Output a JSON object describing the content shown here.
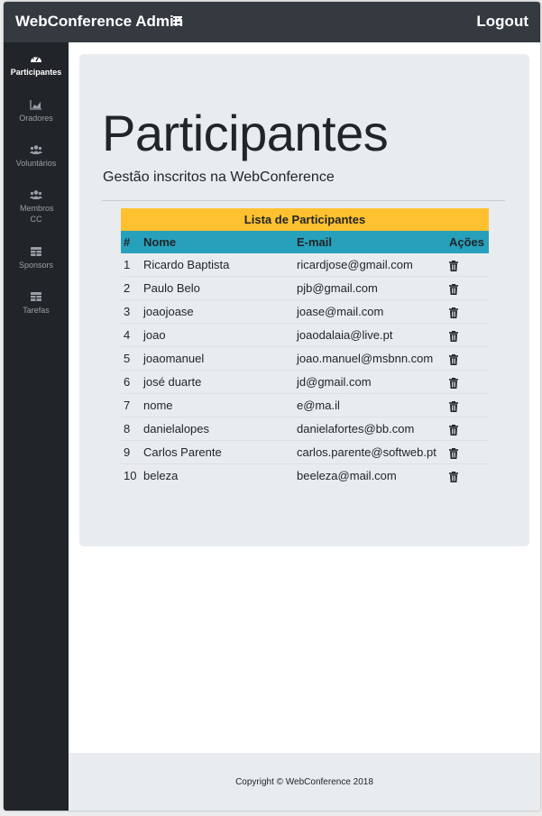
{
  "header": {
    "brand": "WebConference Admin",
    "logout": "Logout"
  },
  "sidebar": {
    "items": [
      {
        "label": "Participantes",
        "icon": "dashboard-icon",
        "active": true
      },
      {
        "label": "Oradores",
        "icon": "area-chart-icon",
        "active": false
      },
      {
        "label": "Voluntários",
        "icon": "users-icon",
        "active": false
      },
      {
        "label": "Membros CC",
        "icon": "users-icon",
        "active": false
      },
      {
        "label": "Sponsors",
        "icon": "table-icon",
        "active": false
      },
      {
        "label": "Tarefas",
        "icon": "table-icon",
        "active": false
      }
    ]
  },
  "main": {
    "title": "Participantes",
    "subtitle": "Gestão inscritos na WebConference",
    "table": {
      "caption": "Lista de Participantes",
      "columns": [
        "#",
        "Nome",
        "E-mail",
        "Ações"
      ],
      "rows": [
        {
          "num": "1",
          "name": "Ricardo Baptista",
          "email": "ricardjose@gmail.com"
        },
        {
          "num": "2",
          "name": "Paulo Belo",
          "email": "pjb@gmail.com"
        },
        {
          "num": "3",
          "name": "joaojoase",
          "email": "joase@mail.com"
        },
        {
          "num": "4",
          "name": "joao",
          "email": "joaodalaia@live.pt"
        },
        {
          "num": "5",
          "name": "joaomanuel",
          "email": "joao.manuel@msbnn.com"
        },
        {
          "num": "6",
          "name": "josé duarte",
          "email": "jd@gmail.com"
        },
        {
          "num": "7",
          "name": "nome",
          "email": "e@ma.il"
        },
        {
          "num": "8",
          "name": "danielalopes",
          "email": "danielafortes@bb.com"
        },
        {
          "num": "9",
          "name": "Carlos Parente",
          "email": "carlos.parente@softweb.pt"
        },
        {
          "num": "10",
          "name": "beleza",
          "email": "beeleza@mail.com"
        }
      ]
    }
  },
  "footer": {
    "copyright": "Copyright © WebConference 2018"
  },
  "colors": {
    "topbar": "#343a40",
    "sidebar": "#212529",
    "caption": "#ffc12f",
    "table_header": "#27a0bb",
    "jumbotron": "#e9ecef"
  }
}
